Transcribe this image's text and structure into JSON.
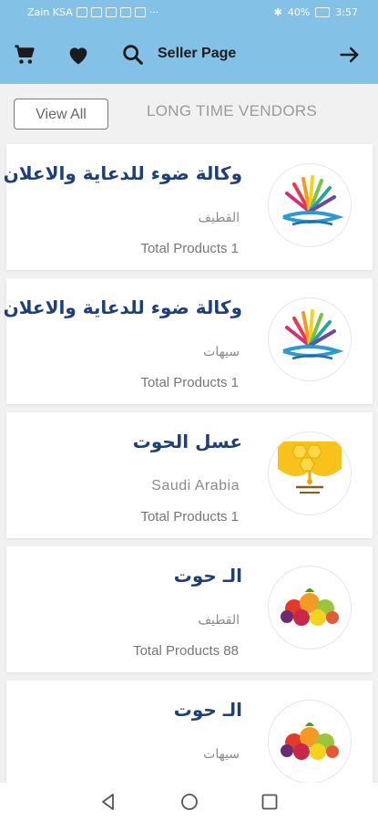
{
  "status": {
    "carrier": "Zain KSA",
    "battery": "40%",
    "time": "3:57"
  },
  "app_bar": {
    "title": "Seller Page",
    "icons": [
      "cart-icon",
      "heart-icon",
      "search-icon",
      "arrow-right-icon"
    ]
  },
  "toolbar": {
    "view_all_label": "View All",
    "section_title": "LONG TIME VENDORS"
  },
  "vendors": [
    {
      "name": "وكالة ضوء  للدعاية والاعلان",
      "city": "القطيف",
      "total_products": "Total Products 1",
      "logo": "rainbow-book-logo"
    },
    {
      "name": "وكالة ضوء  للدعاية والاعلان",
      "city": "سيهات",
      "total_products": "Total Products 1",
      "logo": "rainbow-book-logo"
    },
    {
      "name": "عسل الحوت",
      "city": "Saudi Arabia",
      "total_products": "Total Products 1",
      "logo": "honey-logo"
    },
    {
      "name": "الـ حوت",
      "city": "القطيف",
      "total_products": "Total Products 88",
      "logo": "fruit-basket-logo"
    },
    {
      "name": "الـ حوت",
      "city": "سيهات",
      "total_products": "",
      "logo": "fruit-basket-logo"
    }
  ],
  "nav": [
    "back-icon",
    "home-icon",
    "recents-icon"
  ]
}
